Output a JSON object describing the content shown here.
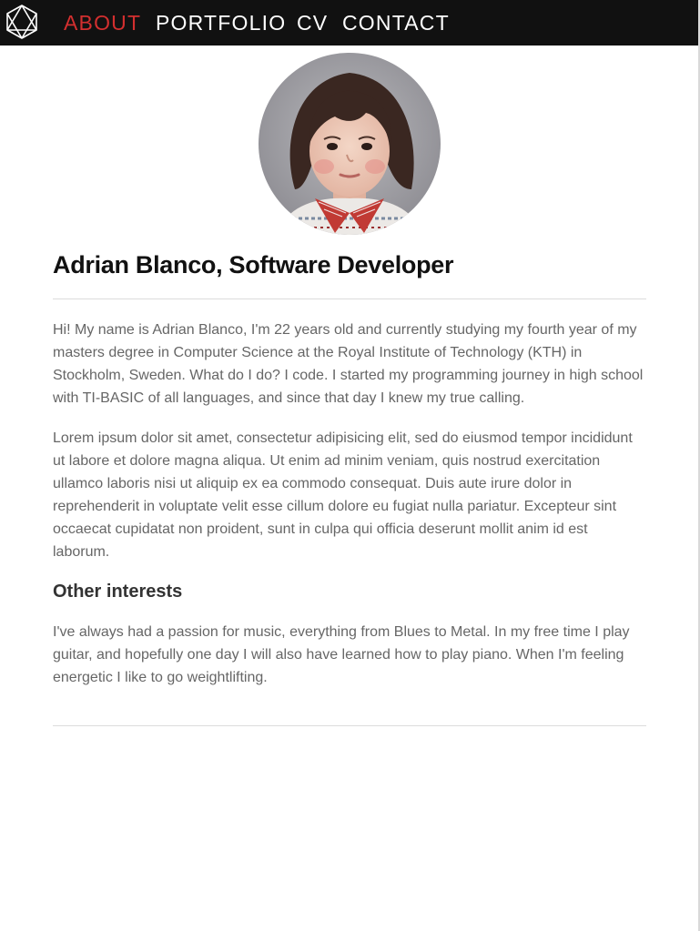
{
  "nav": {
    "logo_icon": "geometric-polyhedron-logo-icon",
    "items": [
      {
        "label": "ABOUT",
        "active": true
      },
      {
        "label": "PORTFOLIO",
        "active": false
      },
      {
        "label": "CV",
        "active": false
      },
      {
        "label": "CONTACT",
        "active": false
      }
    ],
    "active_color": "#d32f2f",
    "background": "#111111"
  },
  "profile": {
    "photo": "child-portrait-photo"
  },
  "main": {
    "title": "Adrian Blanco, Software Developer",
    "paragraphs": [
      "Hi! My name is Adrian Blanco, I'm 22 years old and currently studying my fourth year of my masters degree in Computer Science at the Royal Institute of Technology (KTH) in Stockholm, Sweden. What do I do? I code. I started my programming journey in high school with TI-BASIC of all languages, and since that day I knew my true calling.",
      "Lorem ipsum dolor sit amet, consectetur adipisicing elit, sed do eiusmod tempor incididunt ut labore et dolore magna aliqua. Ut enim ad minim veniam, quis nostrud exercitation ullamco laboris nisi ut aliquip ex ea commodo consequat. Duis aute irure dolor in reprehenderit in voluptate velit esse cillum dolore eu fugiat nulla pariatur. Excepteur sint occaecat cupidatat non proident, sunt in culpa qui officia deserunt mollit anim id est laborum."
    ],
    "interests": {
      "heading": "Other interests",
      "text": "I've always had a passion for music, everything from Blues to Metal. In my free time I play guitar, and hopefully one day I will also have learned how to play piano. When I'm feeling energetic I like to go weightlifting."
    }
  }
}
